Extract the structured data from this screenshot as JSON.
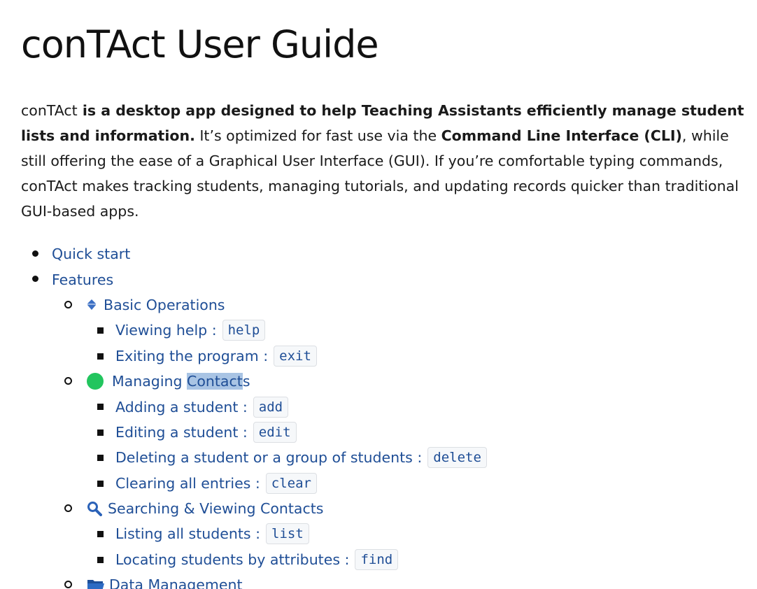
{
  "title": "conTAct User Guide",
  "intro": {
    "p1": "conTAct",
    "p2": " is a desktop app designed to help Teaching Assistants efficiently manage student lists and information.",
    "p3": " It’s optimized for fast use via the ",
    "p4": "Command Line Interface (CLI)",
    "p5": ", while still offering the ease of a Graphical User Interface (GUI). If you’re comfortable typing commands, conTAct makes tracking students, managing tutorials, and updating records quicker than traditional GUI-based apps."
  },
  "toc": {
    "quick_start": "Quick start",
    "features": "Features",
    "basic": {
      "label": "Basic Operations",
      "icon": "diamond-icon",
      "items": [
        {
          "label": "Viewing help : ",
          "cmd": "help"
        },
        {
          "label": "Exiting the program : ",
          "cmd": "exit"
        }
      ]
    },
    "managing": {
      "label_a": "Managing ",
      "label_hl": "Contact",
      "label_b": "s",
      "icon": "green-circle-icon",
      "icon_color": "#22c55e",
      "items": [
        {
          "label": "Adding a student : ",
          "cmd": "add"
        },
        {
          "label": "Editing a student : ",
          "cmd": "edit"
        },
        {
          "label": "Deleting a student or a group of students : ",
          "cmd": "delete"
        },
        {
          "label": "Clearing all entries : ",
          "cmd": "clear"
        }
      ]
    },
    "searching": {
      "label": "Searching & Viewing Contacts",
      "icon": "magnifier-icon",
      "items": [
        {
          "label": "Listing all students : ",
          "cmd": "list"
        },
        {
          "label": "Locating students by attributes : ",
          "cmd": "find"
        }
      ]
    },
    "data": {
      "label": "Data Management",
      "icon": "folder-icon"
    }
  },
  "colors": {
    "link": "#1f4e96",
    "highlight": "#a9c4e4",
    "code_bg": "#f6f8fa"
  }
}
